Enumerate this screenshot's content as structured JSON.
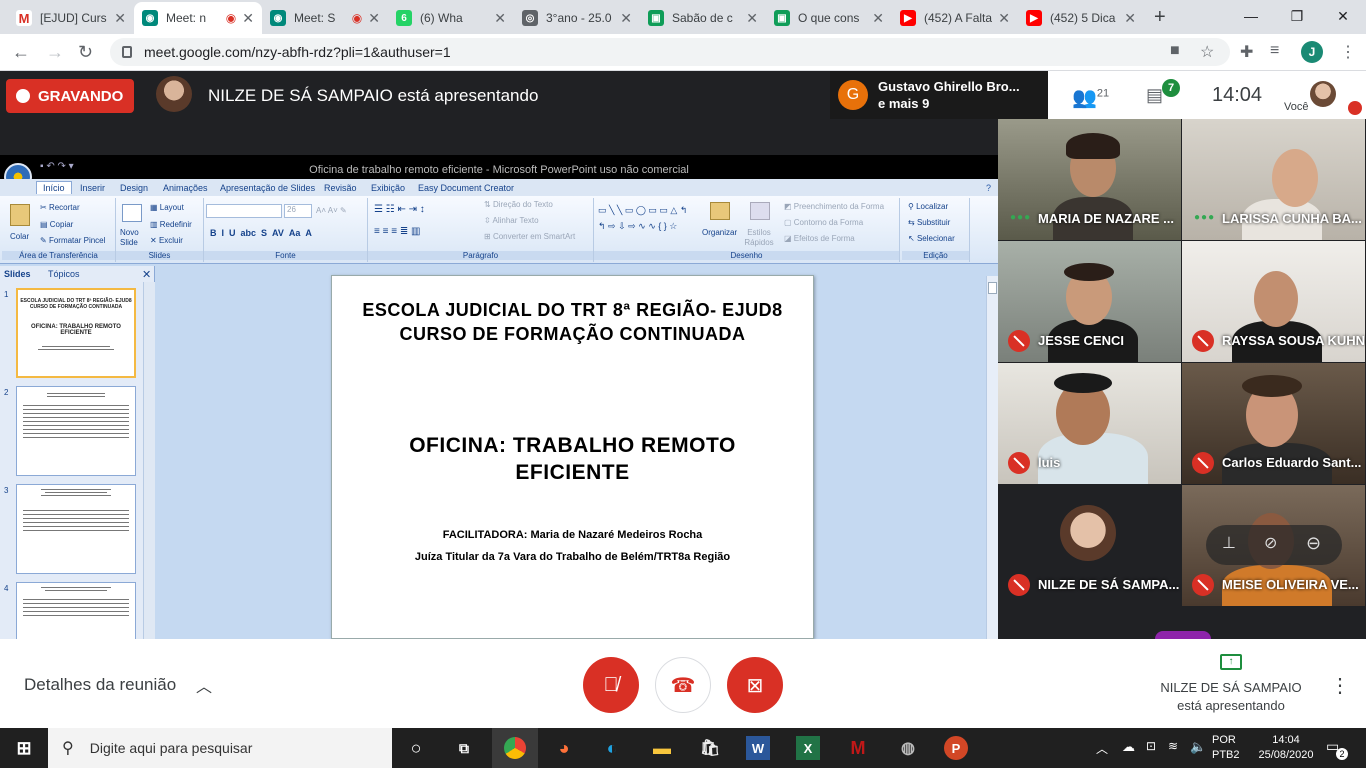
{
  "browser": {
    "tabs": [
      {
        "title": "[EJUD] Curs",
        "icon": "gmail-icon",
        "color": "#d93025",
        "glyph": "M"
      },
      {
        "title": "Meet: n",
        "icon": "meet-icon",
        "color": "#00897b",
        "glyph": "◉",
        "active": true
      },
      {
        "title": "Meet: S",
        "icon": "meet-icon",
        "color": "#00897b",
        "glyph": "◉"
      },
      {
        "title": "(6) Wha",
        "icon": "whatsapp-icon",
        "color": "#25d366",
        "glyph": "6"
      },
      {
        "title": "3°ano - 25.0",
        "icon": "globe-icon",
        "color": "#5f6368",
        "glyph": "◎"
      },
      {
        "title": "Sabão de c",
        "icon": "classroom-icon",
        "color": "#0f9d58",
        "glyph": "▣"
      },
      {
        "title": "O que cons",
        "icon": "classroom-icon",
        "color": "#0f9d58",
        "glyph": "▣"
      },
      {
        "title": "(452) A Falta",
        "icon": "youtube-icon",
        "color": "#ff0000",
        "glyph": "▶"
      },
      {
        "title": "(452) 5 Dica",
        "icon": "youtube-icon",
        "color": "#ff0000",
        "glyph": "▶"
      }
    ],
    "new_tab": "+",
    "url": "meet.google.com/nzy-abfh-rdz?pli=1&authuser=1",
    "profile_initial": "J"
  },
  "meet": {
    "recording_label": "GRAVANDO",
    "presenting_banner": "NILZE DE SÁ SAMPAIO está apresentando",
    "notice_initial": "G",
    "notice_line1": "Gustavo Ghirello Bro...",
    "notice_line2": "e mais 9",
    "people_count": "21",
    "chat_count": "7",
    "time": "14:04",
    "you_label": "Você"
  },
  "ppt": {
    "window_title": "Oficina de trabalho remoto eficiente - Microsoft PowerPoint uso não comercial",
    "tabs": [
      "Início",
      "Inserir",
      "Design",
      "Animações",
      "Apresentação de Slides",
      "Revisão",
      "Exibição",
      "Easy Document Creator"
    ],
    "groups": {
      "clipboard": "Área de Transferência",
      "slides": "Slides",
      "font": "Fonte",
      "paragraph": "Parágrafo",
      "drawing": "Desenho",
      "editing": "Edição"
    },
    "buttons": {
      "paste": "Colar",
      "cut": "Recortar",
      "copy": "Copiar",
      "format_painter": "Formatar Pincel",
      "new_slide": "Novo Slide",
      "layout": "Layout",
      "reset": "Redefinir",
      "delete": "Excluir",
      "font_size": "26",
      "text_direction": "Direção do Texto",
      "align_text": "Alinhar Texto",
      "smartart": "Converter em SmartArt",
      "arrange": "Organizar",
      "quick_styles": "Estilos Rápidos",
      "shape_fill": "Preenchimento da Forma",
      "shape_outline": "Contorno da Forma",
      "shape_effects": "Efeitos de Forma",
      "find": "Localizar",
      "replace": "Substituir",
      "select": "Selecionar"
    },
    "pane_tabs": [
      "Slides",
      "Tópicos"
    ],
    "thumbs": [
      "1",
      "2",
      "3",
      "4"
    ],
    "thumb1_lines": [
      "ESCOLA JUDICIAL DO TRT 8ª REGIÃO- EJUD8",
      "CURSO DE FORMAÇÃO CONTINUADA",
      "OFICINA: TRABALHO REMOTO",
      "EFICIENTE"
    ],
    "slide": {
      "line1": "ESCOLA JUDICIAL  DO TRT 8ª REGIÃO- EJUD8",
      "line2": "CURSO DE FORMAÇÃO CONTINUADA",
      "title1": "OFICINA: TRABALHO REMOTO",
      "title2": "EFICIENTE",
      "facilitator": "FACILITADORA: Maria de Nazaré Medeiros Rocha",
      "role": "Juíza Titular da 7a Vara do Trabalho de Belém/TRT8a Região"
    }
  },
  "participants": [
    {
      "name": "MARIA DE NAZARE ...",
      "muted": false
    },
    {
      "name": "LARISSA CUNHA BA...",
      "muted": false
    },
    {
      "name": "JESSE CENCI",
      "muted": true
    },
    {
      "name": "RAYSSA SOUSA KUHN",
      "muted": true
    },
    {
      "name": "luis",
      "muted": true
    },
    {
      "name": "Carlos Eduardo Sant...",
      "muted": true
    },
    {
      "name": "NILZE DE SÁ SAMPA...",
      "muted": true
    },
    {
      "name": "MEISE OLIVEIRA VE...",
      "muted": true
    }
  ],
  "bottom": {
    "details": "Detalhes da reunião",
    "presenting_name": "NILZE DE SÁ SAMPAIO",
    "presenting_suffix": "está apresentando"
  },
  "taskbar": {
    "search_placeholder": "Digite aqui para pesquisar",
    "lang1": "POR",
    "lang2": "PTB2",
    "time": "14:04",
    "date": "25/08/2020",
    "notifications": "2"
  }
}
